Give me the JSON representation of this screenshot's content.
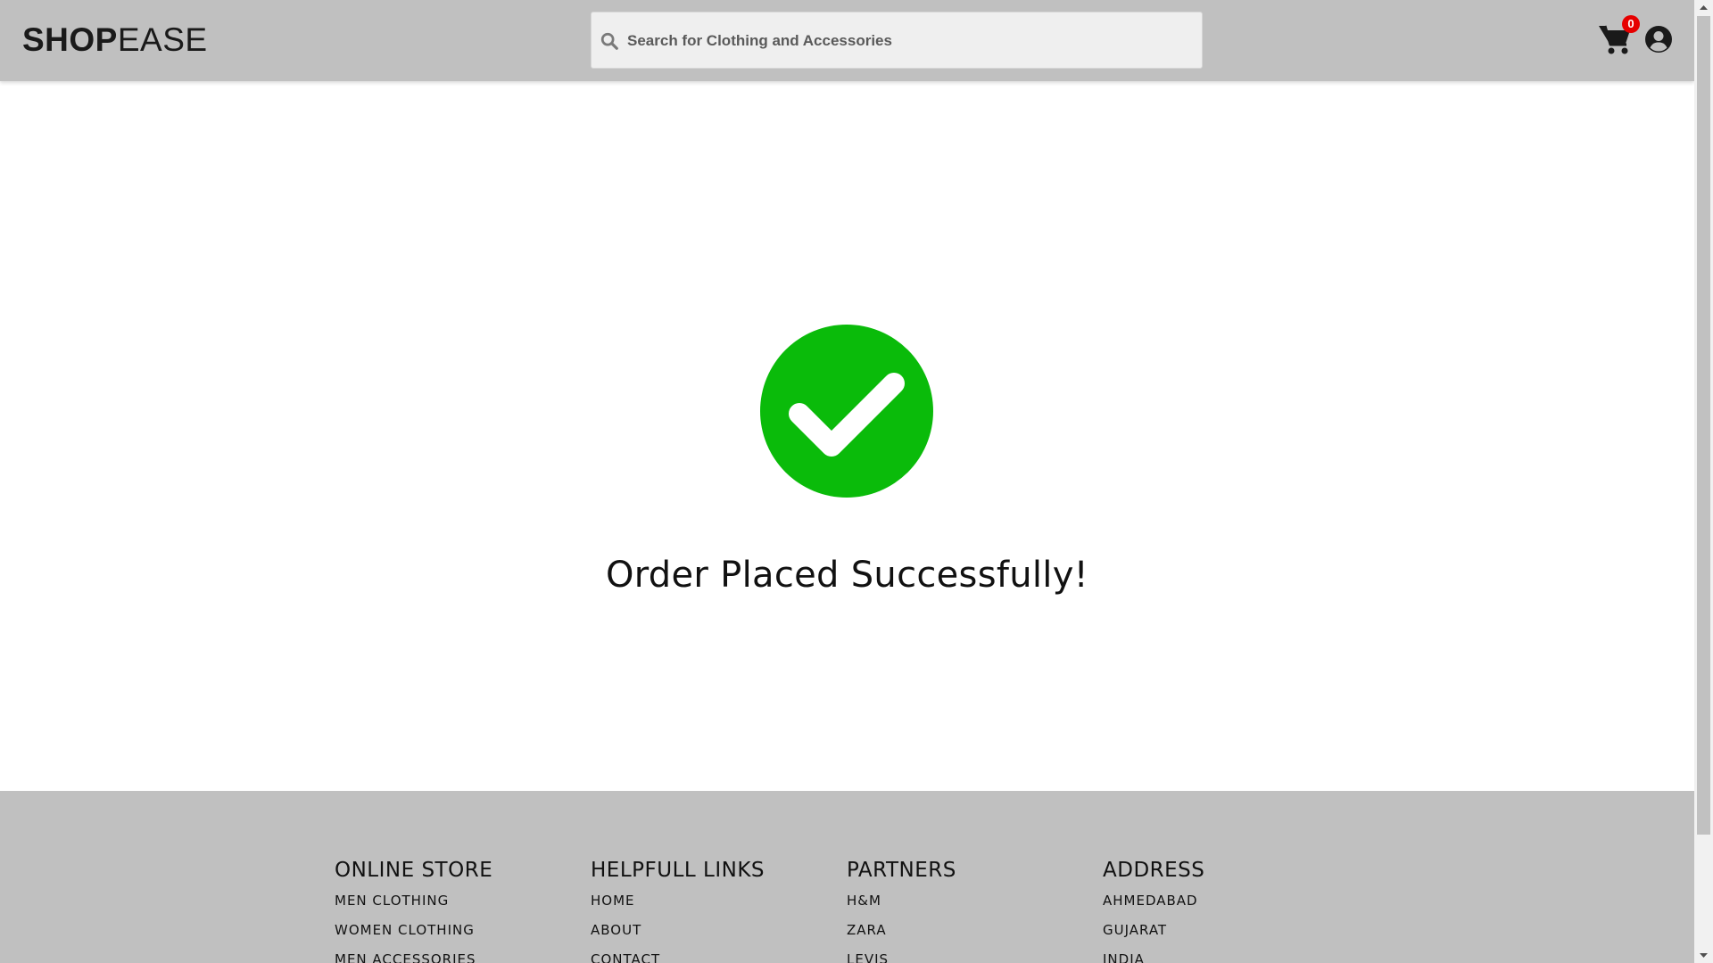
{
  "header": {
    "logo_bold": "SHOP",
    "logo_light": "EASE",
    "search_placeholder": "Search for Clothing and Accessories",
    "cart_count": "0"
  },
  "main": {
    "success_message": "Order Placed Successfully!"
  },
  "footer": {
    "columns": [
      {
        "title": "ONLINE STORE",
        "links": [
          "MEN CLOTHING",
          "WOMEN CLOTHING",
          "MEN ACCESSORIES"
        ]
      },
      {
        "title": "HELPFULL LINKS",
        "links": [
          "HOME",
          "ABOUT",
          "CONTACT"
        ]
      },
      {
        "title": "PARTNERS",
        "links": [
          "H&M",
          "ZARA",
          "LEVIS"
        ]
      },
      {
        "title": "ADDRESS",
        "links": [
          "AHMEDABAD",
          "GUJARAT",
          "INDIA"
        ]
      }
    ]
  },
  "colors": {
    "header_bg": "#c0c0c0",
    "success_green": "#0abb0a",
    "badge_red": "#e60000"
  },
  "icons": [
    "search-icon",
    "cart-icon",
    "user-circle-icon",
    "check-circle-icon"
  ]
}
